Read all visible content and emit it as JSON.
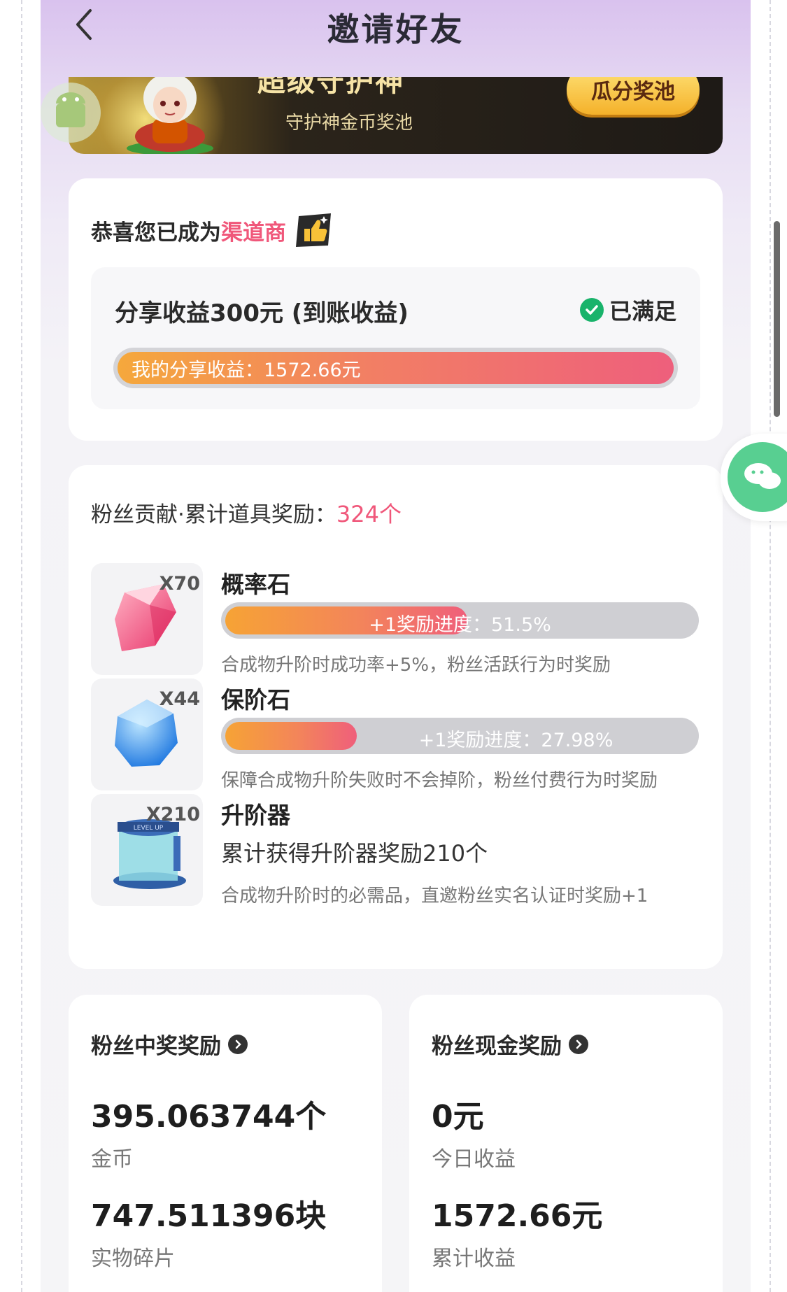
{
  "header": {
    "title": "邀请好友"
  },
  "banner": {
    "title_fragment": "超级守护神",
    "subtitle": "守护神金币奖池",
    "button": "瓜分奖池"
  },
  "channel_card": {
    "congrats_prefix": "恭喜您已成为",
    "congrats_highlight": "渠道商",
    "share_title": "分享收益300元 (到账收益)",
    "status": "已满足",
    "progress_label": "我的分享收益：1572.66元",
    "progress_fraction": 1.0
  },
  "fans_card": {
    "title": "粉丝贡献·累计道具奖励：",
    "count": "324个",
    "items": [
      {
        "name": "概率石",
        "qty": "X70",
        "progress_text": "+1奖励进度：51.5%",
        "progress_fraction": 0.515,
        "desc": "合成物升阶时成功率+5%，粉丝活跃行为时奖励"
      },
      {
        "name": "保阶石",
        "qty": "X44",
        "progress_text": "+1奖励进度：27.98%",
        "progress_fraction": 0.2798,
        "desc": "保障合成物升阶失败时不会掉阶，粉丝付费行为时奖励"
      },
      {
        "name": "升阶器",
        "qty": "X210",
        "line": "累计获得升阶器奖励210个",
        "desc": "合成物升阶时的必需品，直邀粉丝实名认证时奖励+1",
        "icon_text": "LEVEL UP"
      }
    ]
  },
  "prize_card": {
    "title": "粉丝中奖奖励",
    "value1": "395.063744个",
    "label1": "金币",
    "value2": "747.511396块",
    "label2": "实物碎片"
  },
  "cash_card": {
    "title": "粉丝现金奖励",
    "value1": "0元",
    "label1": "今日收益",
    "value2": "1572.66元",
    "label2": "累计收益"
  },
  "colors": {
    "accent_pink": "#f0577a",
    "success_green": "#19b36b",
    "chat_green": "#58cf91"
  },
  "icons": [
    "back-arrow-icon",
    "thumbs-up-icon",
    "check-circle-icon",
    "chevron-right-icon",
    "chat-bubble-icon",
    "android-icon"
  ]
}
